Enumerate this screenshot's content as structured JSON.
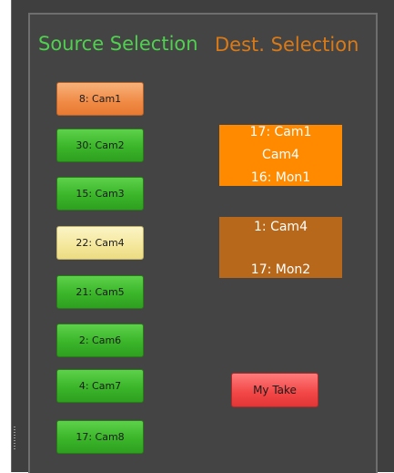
{
  "headings": {
    "source": "Source Selection",
    "dest": "Dest. Selection"
  },
  "sources": [
    {
      "label": "8: Cam1",
      "state": "selected-orange"
    },
    {
      "label": "30: Cam2",
      "state": "normal"
    },
    {
      "label": "15: Cam3",
      "state": "normal"
    },
    {
      "label": "22: Cam4",
      "state": "selected-yellow"
    },
    {
      "label": "21: Cam5",
      "state": "normal"
    },
    {
      "label": "2: Cam6",
      "state": "normal"
    },
    {
      "label": "4: Cam7",
      "state": "normal"
    },
    {
      "label": "17: Cam8",
      "state": "normal"
    }
  ],
  "destinations": [
    {
      "line1": "17: Cam1",
      "line2": "Cam4",
      "line3": "16: Mon1",
      "color": "#ff8a00"
    },
    {
      "line1": "1: Cam4",
      "line2": "",
      "line3": "17: Mon2",
      "color": "#b8681a"
    }
  ],
  "take": {
    "label": "My Take"
  },
  "colors": {
    "source_heading": "#4fd04f",
    "dest_heading": "#d97a17",
    "button_green": "#3bb52a",
    "button_orange": "#f08a45",
    "button_yellow": "#f4e79b",
    "take_red": "#f24545"
  }
}
